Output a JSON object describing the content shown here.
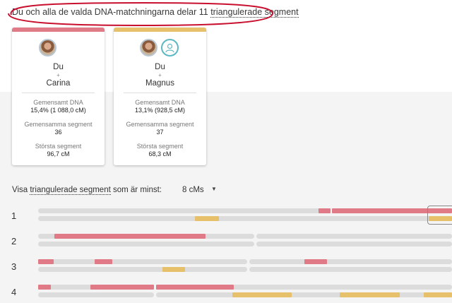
{
  "header": {
    "prefix": "Du och alla de valda DNA-matchningarna delar 11 ",
    "link": "triangulerade segment"
  },
  "cards": [
    {
      "you": "Du",
      "plus": "+",
      "match": "Carina",
      "shared_dna_label": "Gemensamt DNA",
      "shared_dna_value": "15,4% (1 088,0 cM)",
      "shared_segments_label": "Gemensamma segment",
      "shared_segments_value": "36",
      "largest_segment_label": "Största segment",
      "largest_segment_value": "96,7 cM",
      "color": "#e07a87"
    },
    {
      "you": "Du",
      "plus": "+",
      "match": "Magnus",
      "shared_dna_label": "Gemensamt DNA",
      "shared_dna_value": "13,1% (928,5 cM)",
      "shared_segments_label": "Gemensamma segment",
      "shared_segments_value": "37",
      "largest_segment_label": "Största segment",
      "largest_segment_value": "68,3 cM",
      "color": "#e6c06a"
    }
  ],
  "filter": {
    "prefix": "Visa ",
    "link": "triangulerade segment",
    "suffix": " som är minst:",
    "value": "8 cMs",
    "caret_icon": "caret-down-icon"
  },
  "chromosomes": [
    {
      "label": "1"
    },
    {
      "label": "2"
    },
    {
      "label": "3"
    },
    {
      "label": "4"
    }
  ]
}
